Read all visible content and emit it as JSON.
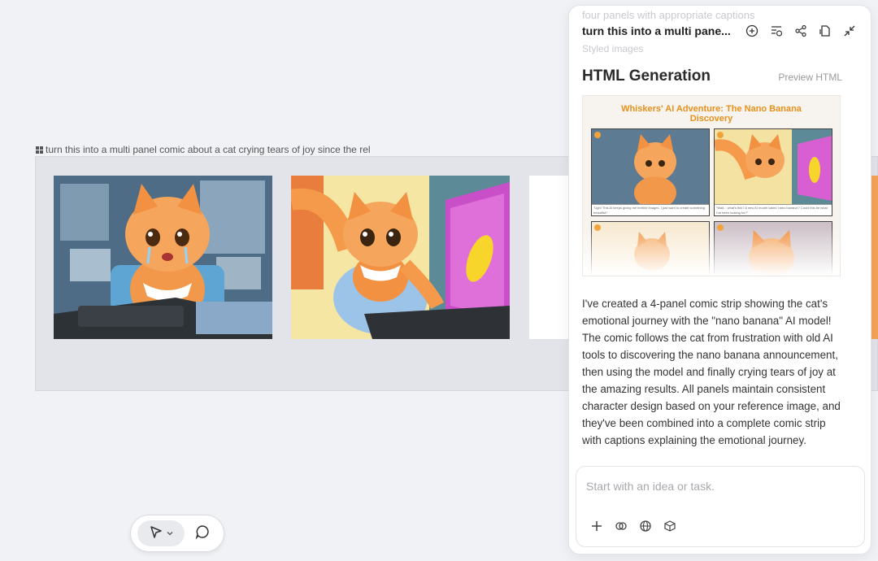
{
  "canvas": {
    "frame_label": "turn this into a multi panel comic about a cat crying tears of joy since the rel"
  },
  "toolbar": {
    "select_tool_icon": "pointer-arrow-icon",
    "select_dropdown_icon": "chevron-down-icon",
    "comment_tool_icon": "comment-bubble-icon"
  },
  "side_panel": {
    "ghost_top": "four panels with appropriate captions",
    "ghost_second": "Styled images",
    "title": "turn this into a multi pane...",
    "header_icons": [
      "add-circle-icon",
      "history-list-icon",
      "share-icon",
      "document-icon",
      "collapse-icon"
    ],
    "section_title": "HTML Generation",
    "preview_link": "Preview HTML",
    "preview": {
      "comic_title": "Whiskers' AI Adventure: The Nano Banana Discovery",
      "panels": [
        {
          "num": "1",
          "caption": "\"Ugh! This AI keeps giving me terrible images. I just want to create something beautiful!\""
        },
        {
          "num": "2",
          "caption": "\"Wait... what's this? A new AI model called 'nano banana'? Could this be what I've been looking for?\""
        },
        {
          "num": "3",
          "caption": ""
        },
        {
          "num": "4",
          "caption": ""
        }
      ]
    },
    "response": "I've created a 4-panel comic strip showing the cat's emotional journey with the \"nano banana\" AI model! The comic follows the cat from frustration with old AI tools to discovering the nano banana announcement, then using the model and finally crying tears of joy at the amazing results. All panels maintain consistent character design based on your reference image, and they've been combined into a complete comic strip with captions explaining the emotional journey.",
    "input_placeholder": "Start with an idea or task.",
    "input_tools": [
      "plus-icon",
      "attach-icon",
      "globe-icon",
      "cube-icon"
    ]
  },
  "colors": {
    "accent_orange": "#e8901b",
    "panel_border": "#e2e3e8",
    "canvas_bg": "#f1f2f5"
  }
}
